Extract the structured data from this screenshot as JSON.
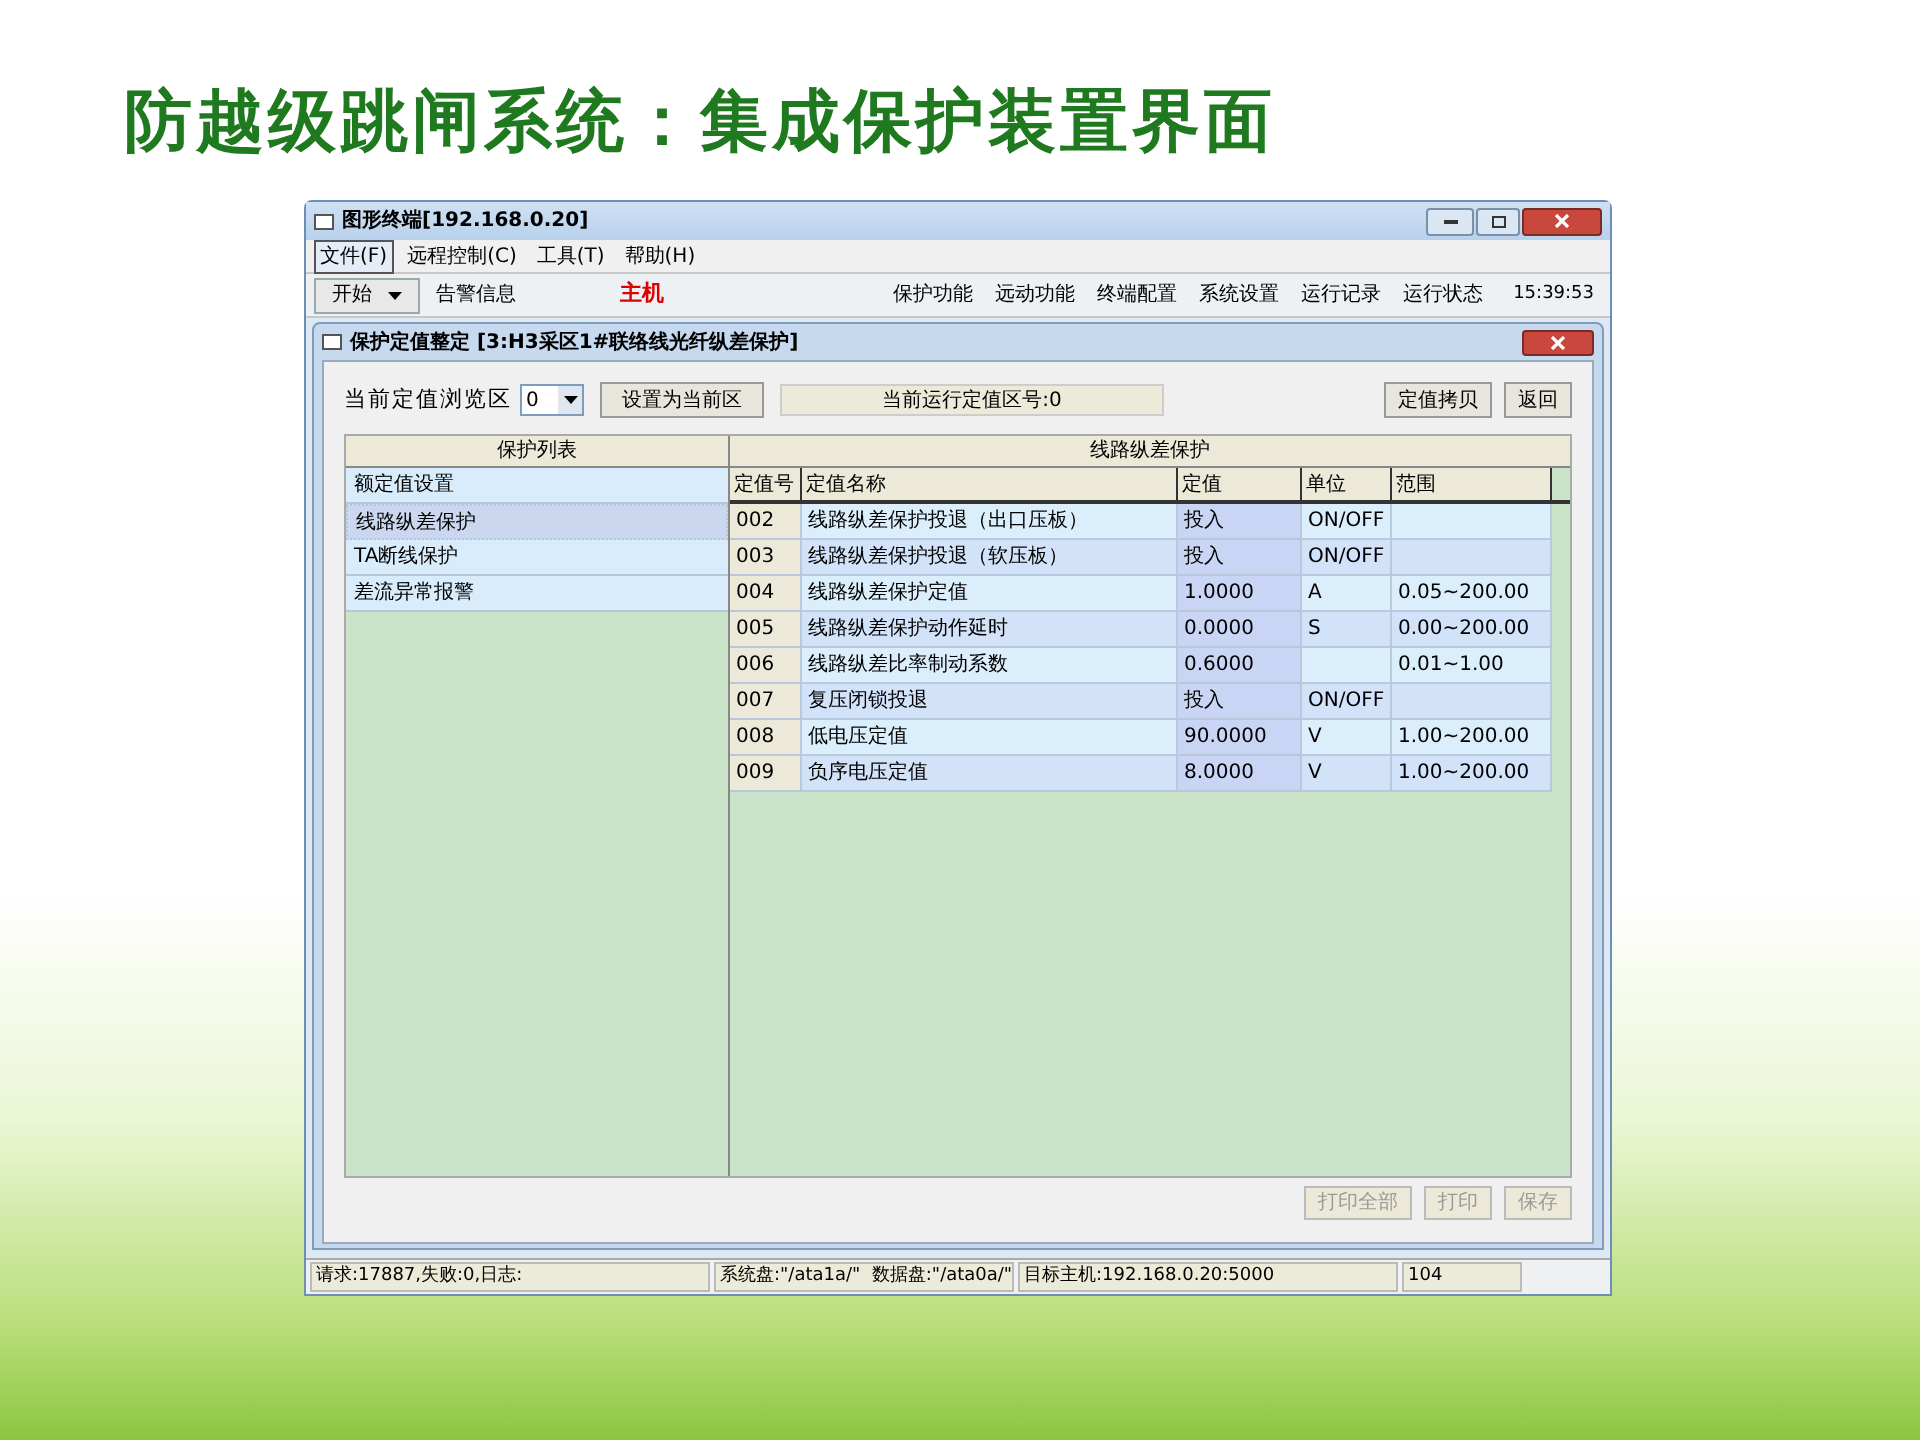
{
  "slide_title": "防越级跳闸系统：集成保护装置界面",
  "window": {
    "title": "图形终端[192.168.0.20]"
  },
  "menu": [
    {
      "label": "文件(F)",
      "selected": true
    },
    {
      "label": "远程控制(C)",
      "selected": false
    },
    {
      "label": "工具(T)",
      "selected": false
    },
    {
      "label": "帮助(H)",
      "selected": false
    }
  ],
  "toolbar": {
    "start": "开始",
    "alarm": "告警信息",
    "host": "主机",
    "functions": [
      "保护功能",
      "远动功能",
      "终端配置",
      "系统设置",
      "运行记录",
      "运行状态"
    ],
    "clock": "15:39:53"
  },
  "dialog": {
    "title": "保护定值整定 [3:H3采区1#联络线光纤纵差保护]",
    "zone_label": "当前定值浏览区",
    "zone_value": "0",
    "set_current_button": "设置为当前区",
    "running_zone": "当前运行定值区号:0",
    "buttons": [
      "定值拷贝",
      "返回"
    ]
  },
  "protection_list": {
    "header": "保护列表",
    "items": [
      {
        "label": "额定值设置",
        "selected": false
      },
      {
        "label": "线路纵差保护",
        "selected": true
      },
      {
        "label": "TA断线保护",
        "selected": false
      },
      {
        "label": "差流异常报警",
        "selected": false
      }
    ]
  },
  "settings_table": {
    "title": "线路纵差保护",
    "columns": [
      "定值号",
      "定值名称",
      "定值",
      "单位",
      "范围"
    ],
    "rows": [
      [
        "002",
        "线路纵差保护投退（出口压板）",
        "投入",
        "ON/OFF",
        ""
      ],
      [
        "003",
        "线路纵差保护投退（软压板）",
        "投入",
        "ON/OFF",
        ""
      ],
      [
        "004",
        "线路纵差保护定值",
        "1.0000",
        "A",
        "0.05~200.00"
      ],
      [
        "005",
        "线路纵差保护动作延时",
        "0.0000",
        "S",
        "0.00~200.00"
      ],
      [
        "006",
        "线路纵差比率制动系数",
        "0.6000",
        "",
        "0.01~1.00"
      ],
      [
        "007",
        "复压闭锁投退",
        "投入",
        "ON/OFF",
        ""
      ],
      [
        "008",
        "低电压定值",
        "90.0000",
        "V",
        "1.00~200.00"
      ],
      [
        "009",
        "负序电压定值",
        "8.0000",
        "V",
        "1.00~200.00"
      ]
    ]
  },
  "footer_buttons": [
    {
      "label": "打印全部",
      "disabled": true
    },
    {
      "label": "打印",
      "disabled": true
    },
    {
      "label": "保存",
      "disabled": true
    }
  ],
  "status_bar": [
    "请求:17887,失败:0,日志:",
    "系统盘:\"/ata1a/\"  数据盘:\"/ata0a/\"",
    "目标主机:192.168.0.20:5000",
    "104"
  ]
}
